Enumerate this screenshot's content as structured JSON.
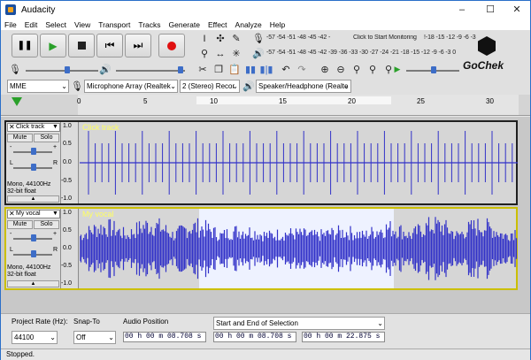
{
  "window": {
    "title": "Audacity",
    "minimize": "–",
    "maximize": "☐",
    "close": "✕"
  },
  "menu": [
    "File",
    "Edit",
    "Select",
    "View",
    "Transport",
    "Tracks",
    "Generate",
    "Effect",
    "Analyze",
    "Help"
  ],
  "meters": {
    "record_scale": "-57 -54 -51 -48 -45 -42 -",
    "record_prompt": "Click to Start Monitoring",
    "record_scale_right": "!-18 -15 -12 -9 -6 -3 0",
    "playback_scale": "-57 -54 -51 -48 -45 -42 -39 -36 -33 -30 -27 -24 -21 -18 -15 -12 -9 -6 -3 0"
  },
  "watermark": {
    "text": "GoChek"
  },
  "devices": {
    "host": "MME",
    "input": "Microphone Array (Realtek",
    "channels": "2 (Stereo) Recor",
    "output": "Speaker/Headphone (Realte"
  },
  "ruler": {
    "ticks": [
      "0",
      "5",
      "10",
      "15",
      "20",
      "25",
      "30"
    ]
  },
  "tracks": [
    {
      "name": "Click track",
      "mute": "Mute",
      "solo": "Solo",
      "info1": "Mono, 44100Hz",
      "info2": "32-bit float",
      "scale": [
        "1.0",
        "0.5",
        "0.0",
        "-0.5",
        "-1.0"
      ],
      "label": "Click track",
      "pan_l": "L",
      "pan_r": "R",
      "gain_minus": "-",
      "gain_plus": "+"
    },
    {
      "name": "My vocal",
      "mute": "Mute",
      "solo": "Solo",
      "info1": "Mono, 44100Hz",
      "info2": "32-bit float",
      "scale": [
        "1.0",
        "0.5",
        "0.0",
        "-0.5",
        "-1.0"
      ],
      "label": "My vocal",
      "pan_l": "L",
      "pan_r": "R",
      "gain_minus": "-",
      "gain_plus": "+"
    }
  ],
  "selection_bar": {
    "rate_label": "Project Rate (Hz):",
    "rate_value": "44100",
    "snap_label": "Snap-To",
    "snap_value": "Off",
    "audio_pos_label": "Audio Position",
    "audio_pos_value": "00 h 00 m 08.708 s",
    "sel_mode": "Start and End of Selection",
    "sel_start": "00 h 00 m 08.708 s",
    "sel_end": "00 h 00 m 22.875 s"
  },
  "status": "Stopped.",
  "colors": {
    "wave": "#3232c8",
    "selection": "#eef2ff",
    "label": "#ffff60",
    "accent": "#3d6dc7"
  }
}
